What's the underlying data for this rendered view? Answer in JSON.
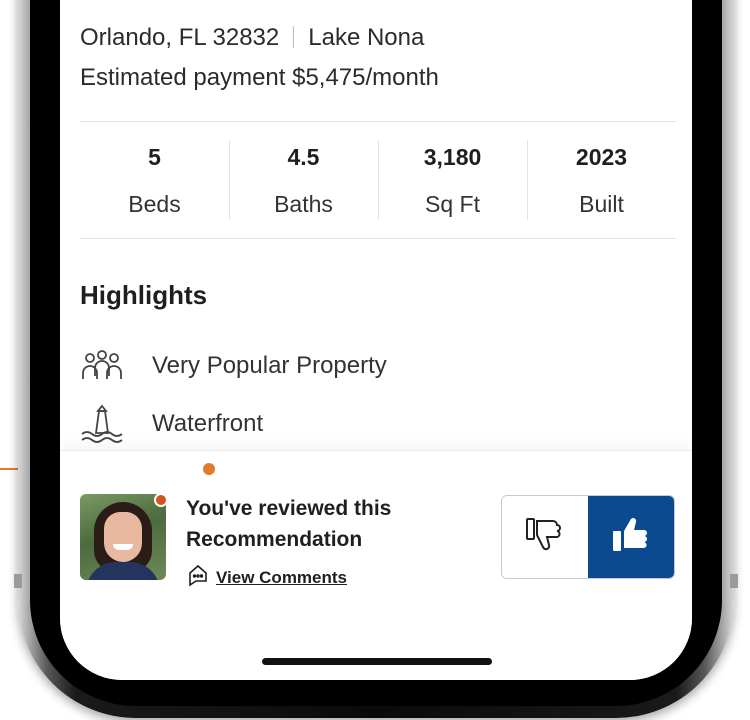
{
  "listing": {
    "city_state_zip": "Orlando, FL 32832",
    "neighborhood": "Lake Nona",
    "estimated_payment": "Estimated payment $5,475/month"
  },
  "stats": [
    {
      "value": "5",
      "label": "Beds"
    },
    {
      "value": "4.5",
      "label": "Baths"
    },
    {
      "value": "3,180",
      "label": "Sq Ft"
    },
    {
      "value": "2023",
      "label": "Built"
    }
  ],
  "highlights": {
    "title": "Highlights",
    "items": [
      {
        "icon": "people-group-icon",
        "label": "Very Popular Property"
      },
      {
        "icon": "waterfront-lighthouse-icon",
        "label": "Waterfront"
      }
    ]
  },
  "review": {
    "title": "You've reviewed this Recommendation",
    "view_comments": "View Comments",
    "status_dot_color": "#d2541b",
    "thumbs_up_selected": true,
    "accent_color": "#0c4a8f"
  },
  "annotation": {
    "color": "#e07c2a"
  }
}
